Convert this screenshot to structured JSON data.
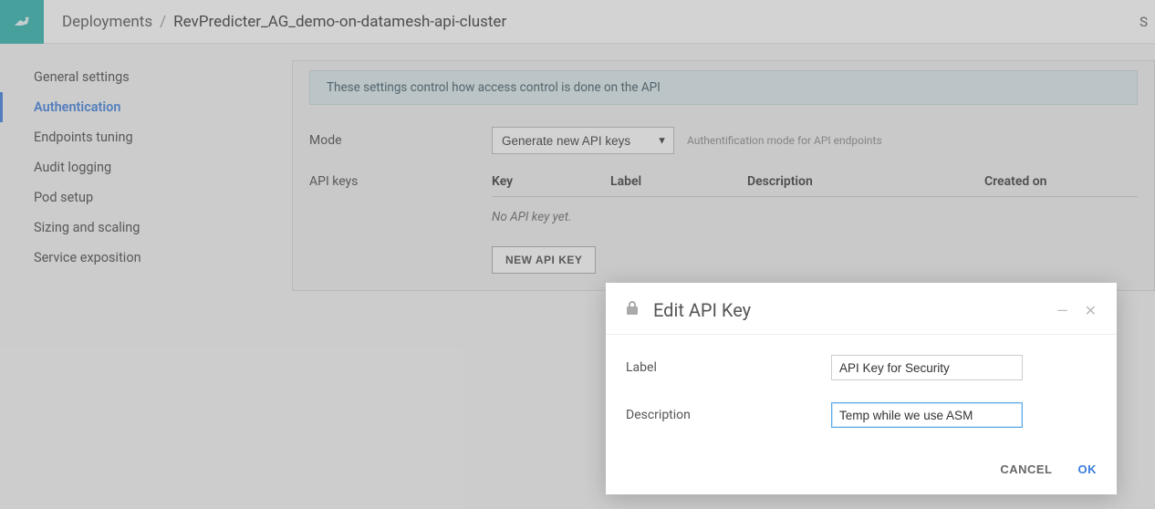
{
  "topbar": {
    "breadcrumb_root": "Deployments",
    "breadcrumb_current": "RevPredicter_AG_demo-on-datamesh-api-cluster",
    "right_label": "S"
  },
  "sidebar": {
    "items": [
      {
        "label": "General settings"
      },
      {
        "label": "Authentication",
        "active": true
      },
      {
        "label": "Endpoints tuning"
      },
      {
        "label": "Audit logging"
      },
      {
        "label": "Pod setup"
      },
      {
        "label": "Sizing and scaling"
      },
      {
        "label": "Service exposition"
      }
    ]
  },
  "panel": {
    "banner": "These settings control how access control is done on the API",
    "mode_label": "Mode",
    "mode_value": "Generate new API keys",
    "mode_hint": "Authentification mode for API endpoints",
    "apikeys_label": "API keys",
    "table": {
      "col_key": "Key",
      "col_label": "Label",
      "col_desc": "Description",
      "col_created": "Created on"
    },
    "empty_text": "No API key yet.",
    "new_key_btn": "NEW API KEY"
  },
  "modal": {
    "title": "Edit API Key",
    "label_label": "Label",
    "label_value": "API Key for Security",
    "desc_label": "Description",
    "desc_value": "Temp while we use ASM",
    "cancel": "CANCEL",
    "ok": "OK"
  }
}
